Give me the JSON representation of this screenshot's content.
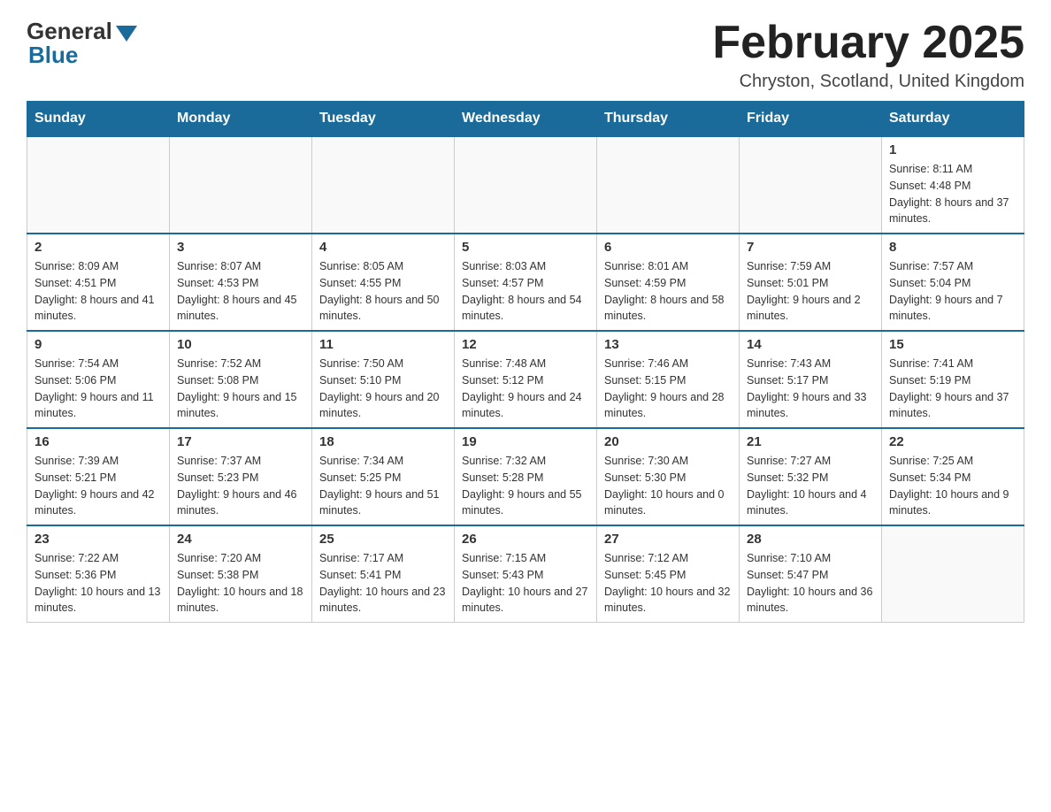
{
  "header": {
    "logo": {
      "general": "General",
      "blue": "Blue"
    },
    "title": "February 2025",
    "location": "Chryston, Scotland, United Kingdom"
  },
  "calendar": {
    "weekdays": [
      "Sunday",
      "Monday",
      "Tuesday",
      "Wednesday",
      "Thursday",
      "Friday",
      "Saturday"
    ],
    "weeks": [
      [
        {
          "day": "",
          "info": ""
        },
        {
          "day": "",
          "info": ""
        },
        {
          "day": "",
          "info": ""
        },
        {
          "day": "",
          "info": ""
        },
        {
          "day": "",
          "info": ""
        },
        {
          "day": "",
          "info": ""
        },
        {
          "day": "1",
          "info": "Sunrise: 8:11 AM\nSunset: 4:48 PM\nDaylight: 8 hours and 37 minutes."
        }
      ],
      [
        {
          "day": "2",
          "info": "Sunrise: 8:09 AM\nSunset: 4:51 PM\nDaylight: 8 hours and 41 minutes."
        },
        {
          "day": "3",
          "info": "Sunrise: 8:07 AM\nSunset: 4:53 PM\nDaylight: 8 hours and 45 minutes."
        },
        {
          "day": "4",
          "info": "Sunrise: 8:05 AM\nSunset: 4:55 PM\nDaylight: 8 hours and 50 minutes."
        },
        {
          "day": "5",
          "info": "Sunrise: 8:03 AM\nSunset: 4:57 PM\nDaylight: 8 hours and 54 minutes."
        },
        {
          "day": "6",
          "info": "Sunrise: 8:01 AM\nSunset: 4:59 PM\nDaylight: 8 hours and 58 minutes."
        },
        {
          "day": "7",
          "info": "Sunrise: 7:59 AM\nSunset: 5:01 PM\nDaylight: 9 hours and 2 minutes."
        },
        {
          "day": "8",
          "info": "Sunrise: 7:57 AM\nSunset: 5:04 PM\nDaylight: 9 hours and 7 minutes."
        }
      ],
      [
        {
          "day": "9",
          "info": "Sunrise: 7:54 AM\nSunset: 5:06 PM\nDaylight: 9 hours and 11 minutes."
        },
        {
          "day": "10",
          "info": "Sunrise: 7:52 AM\nSunset: 5:08 PM\nDaylight: 9 hours and 15 minutes."
        },
        {
          "day": "11",
          "info": "Sunrise: 7:50 AM\nSunset: 5:10 PM\nDaylight: 9 hours and 20 minutes."
        },
        {
          "day": "12",
          "info": "Sunrise: 7:48 AM\nSunset: 5:12 PM\nDaylight: 9 hours and 24 minutes."
        },
        {
          "day": "13",
          "info": "Sunrise: 7:46 AM\nSunset: 5:15 PM\nDaylight: 9 hours and 28 minutes."
        },
        {
          "day": "14",
          "info": "Sunrise: 7:43 AM\nSunset: 5:17 PM\nDaylight: 9 hours and 33 minutes."
        },
        {
          "day": "15",
          "info": "Sunrise: 7:41 AM\nSunset: 5:19 PM\nDaylight: 9 hours and 37 minutes."
        }
      ],
      [
        {
          "day": "16",
          "info": "Sunrise: 7:39 AM\nSunset: 5:21 PM\nDaylight: 9 hours and 42 minutes."
        },
        {
          "day": "17",
          "info": "Sunrise: 7:37 AM\nSunset: 5:23 PM\nDaylight: 9 hours and 46 minutes."
        },
        {
          "day": "18",
          "info": "Sunrise: 7:34 AM\nSunset: 5:25 PM\nDaylight: 9 hours and 51 minutes."
        },
        {
          "day": "19",
          "info": "Sunrise: 7:32 AM\nSunset: 5:28 PM\nDaylight: 9 hours and 55 minutes."
        },
        {
          "day": "20",
          "info": "Sunrise: 7:30 AM\nSunset: 5:30 PM\nDaylight: 10 hours and 0 minutes."
        },
        {
          "day": "21",
          "info": "Sunrise: 7:27 AM\nSunset: 5:32 PM\nDaylight: 10 hours and 4 minutes."
        },
        {
          "day": "22",
          "info": "Sunrise: 7:25 AM\nSunset: 5:34 PM\nDaylight: 10 hours and 9 minutes."
        }
      ],
      [
        {
          "day": "23",
          "info": "Sunrise: 7:22 AM\nSunset: 5:36 PM\nDaylight: 10 hours and 13 minutes."
        },
        {
          "day": "24",
          "info": "Sunrise: 7:20 AM\nSunset: 5:38 PM\nDaylight: 10 hours and 18 minutes."
        },
        {
          "day": "25",
          "info": "Sunrise: 7:17 AM\nSunset: 5:41 PM\nDaylight: 10 hours and 23 minutes."
        },
        {
          "day": "26",
          "info": "Sunrise: 7:15 AM\nSunset: 5:43 PM\nDaylight: 10 hours and 27 minutes."
        },
        {
          "day": "27",
          "info": "Sunrise: 7:12 AM\nSunset: 5:45 PM\nDaylight: 10 hours and 32 minutes."
        },
        {
          "day": "28",
          "info": "Sunrise: 7:10 AM\nSunset: 5:47 PM\nDaylight: 10 hours and 36 minutes."
        },
        {
          "day": "",
          "info": ""
        }
      ]
    ]
  }
}
